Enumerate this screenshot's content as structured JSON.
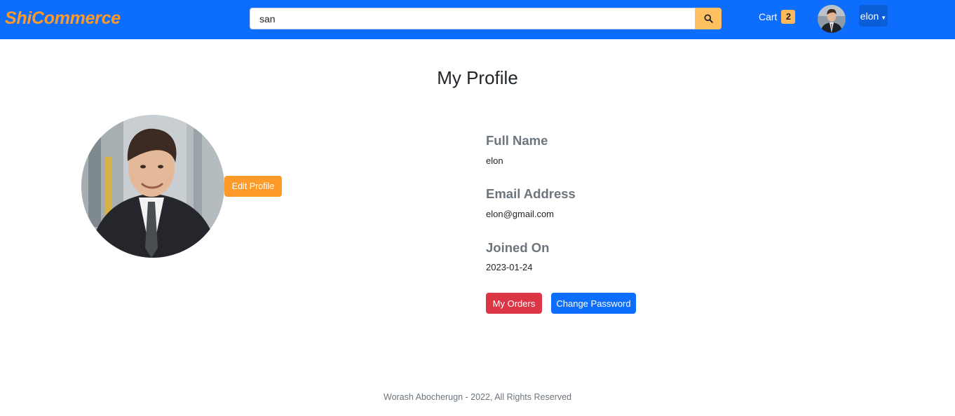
{
  "header": {
    "brand": "ShiCommerce",
    "search": {
      "value": "san",
      "icon": "search-icon"
    },
    "cart": {
      "label": "Cart",
      "count": "2"
    },
    "user": {
      "name": "elon"
    }
  },
  "main": {
    "title": "My Profile",
    "edit_profile_label": "Edit Profile",
    "fields": [
      {
        "label": "Full Name",
        "value": "elon"
      },
      {
        "label": "Email Address",
        "value": "elon@gmail.com"
      },
      {
        "label": "Joined On",
        "value": "2023-01-24"
      }
    ],
    "actions": {
      "orders_label": "My Orders",
      "password_label": "Change Password"
    }
  },
  "footer": {
    "text": "Worash Abocherugn - 2022, All Rights Reserved"
  },
  "colors": {
    "navbar": "#0d6efd",
    "brand": "#fd9a2a",
    "search_button": "#ffc061",
    "edit_button": "#fd9a2a",
    "orders_button": "#dc3545",
    "password_button": "#0d6efd"
  }
}
